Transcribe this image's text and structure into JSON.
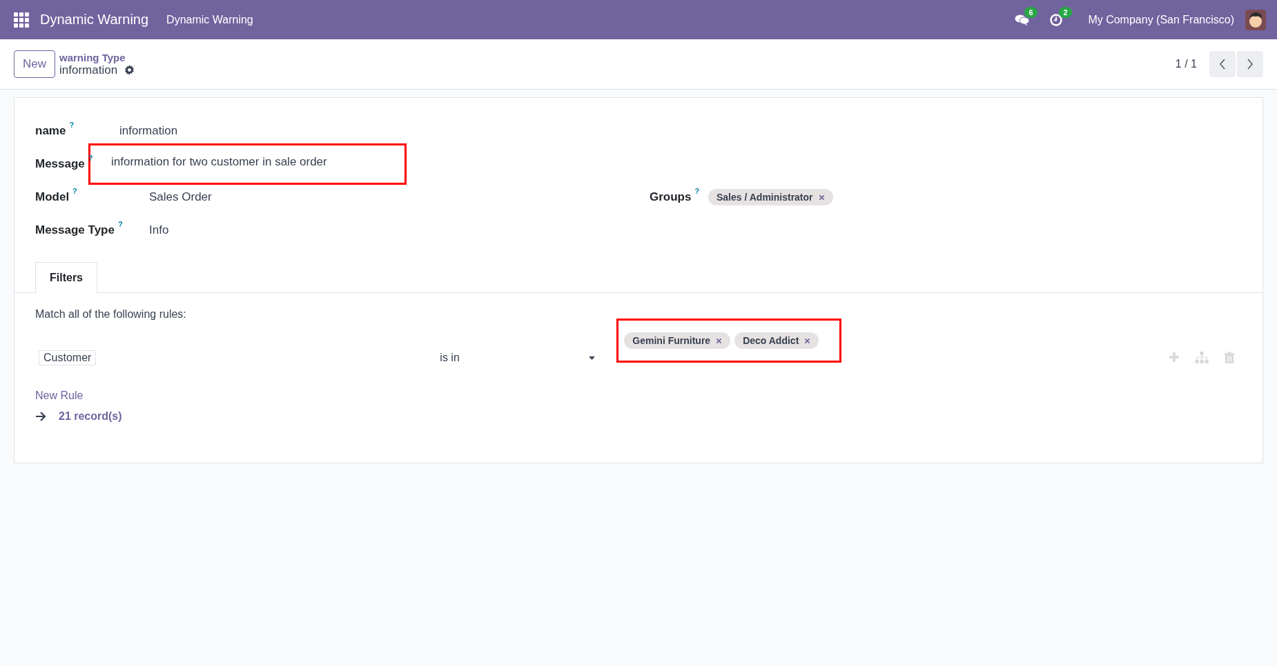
{
  "navbar": {
    "app_name": "Dynamic Warning",
    "menu": [
      "Dynamic Warning"
    ],
    "messages_count": "6",
    "activities_count": "2",
    "company": "My Company (San Francisco)"
  },
  "control_panel": {
    "new_button": "New",
    "breadcrumb": "warning Type",
    "record_name": "information",
    "pager": "1 / 1"
  },
  "form": {
    "fields": [
      {
        "label": "name",
        "help": "?",
        "value": "information",
        "highlighted": false
      },
      {
        "label": "Message",
        "help": "?",
        "value": "information for two customer in sale order",
        "highlighted": true
      },
      {
        "label": "Model",
        "help": "?",
        "value": "Sales Order",
        "highlighted": false
      },
      {
        "label": "Message Type",
        "help": "?",
        "value": "Info",
        "highlighted": false
      }
    ],
    "groups": {
      "label": "Groups",
      "help": "?",
      "tags": [
        "Sales / Administrator"
      ]
    },
    "tabs": [
      {
        "label": "Filters",
        "selected": true
      }
    ],
    "filters": {
      "intro": "Match all of the following rules:",
      "rule": {
        "field": "Customer",
        "operator": "is in",
        "tags": [
          "Gemini Furniture",
          "Deco Addict"
        ],
        "highlighted": true
      },
      "new_rule": "New Rule",
      "records": "21 record(s)"
    }
  }
}
